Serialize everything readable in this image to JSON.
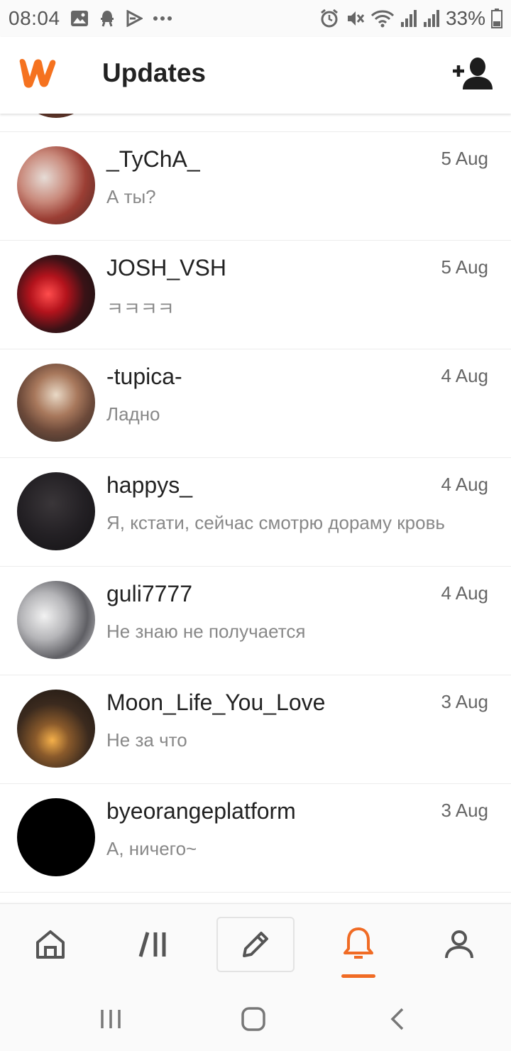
{
  "status_bar": {
    "time": "08:04",
    "battery": "33%",
    "left_icons": [
      "image-icon",
      "android-debug-icon",
      "play-icon",
      "more-dots-icon"
    ],
    "right_icons": [
      "alarm-icon",
      "mute-icon",
      "wifi-icon",
      "signal-icon",
      "signal-icon",
      "battery-icon"
    ]
  },
  "app_bar": {
    "title": "Updates",
    "logo_icon": "wattpad-logo",
    "action_icon": "add-person-icon"
  },
  "conversations": [
    {
      "username": "_TyChA_",
      "message": "А ты?",
      "date": "5 Aug",
      "avatar_color": "#b0564a"
    },
    {
      "username": "JOSH_VSH",
      "message": "ㅋㅋㅋㅋ",
      "date": "5 Aug",
      "avatar_color": "#8a1a1f"
    },
    {
      "username": "-tupica-",
      "message": "Ладно",
      "date": "4 Aug",
      "avatar_color": "#8b7765"
    },
    {
      "username": "happys_",
      "message": "Я, кстати, сейчас смотрю дораму кровь",
      "date": "4 Aug",
      "avatar_color": "#1d1b1e"
    },
    {
      "username": "guli7777",
      "message": "Не знаю не получается",
      "date": "4 Aug",
      "avatar_color": "#8c8c90"
    },
    {
      "username": "Moon_Life_You_Love",
      "message": "Не за что",
      "date": "3 Aug",
      "avatar_color": "#3b2a1e"
    },
    {
      "username": "byeorangeplatform",
      "message": "А, ничего~",
      "date": "3 Aug",
      "avatar_color": "#000000"
    }
  ],
  "bottom_nav": {
    "items": [
      "home-icon",
      "library-icon",
      "write-icon",
      "notifications-icon",
      "profile-icon"
    ],
    "active": "notifications-icon",
    "accent_color": "#f06b24"
  },
  "system_nav": [
    "recents-icon",
    "home-square-icon",
    "back-icon"
  ]
}
